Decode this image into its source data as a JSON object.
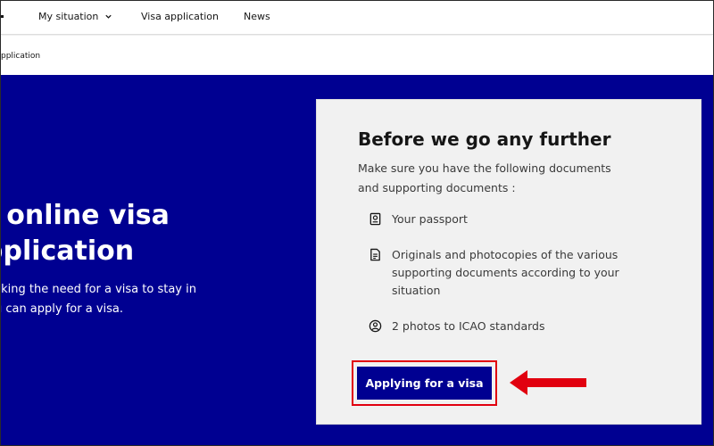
{
  "nav": {
    "items": [
      {
        "label": "My situation",
        "has_dropdown": true
      },
      {
        "label": "Visa application",
        "has_dropdown": false
      },
      {
        "label": "News",
        "has_dropdown": false
      }
    ]
  },
  "breadcrumb": {
    "text": "pplication"
  },
  "hero": {
    "title": "r online visa\npplication",
    "text": "ecking the need for a visa to stay in\nou can apply for a visa."
  },
  "card": {
    "title": "Before we go any further",
    "intro": "Make sure you have the following documents\nand supporting documents :",
    "items": [
      {
        "icon": "passport-icon",
        "label": "Your passport"
      },
      {
        "icon": "document-icon",
        "label": "Originals and photocopies of the various\nsupporting documents according to your\nsituation"
      },
      {
        "icon": "photo-user-icon",
        "label": "2 photos to ICAO standards"
      }
    ],
    "cta_label": "Applying for a visa"
  },
  "colors": {
    "brand_blue": "#000091",
    "annotation_red": "#e1000f",
    "card_bg": "#f1f1f1"
  }
}
